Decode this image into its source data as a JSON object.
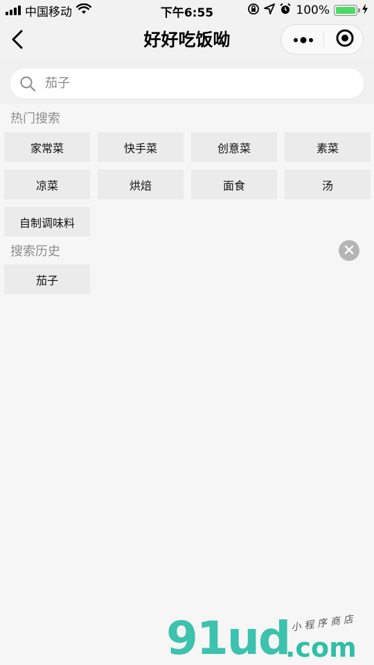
{
  "status_bar": {
    "carrier": "中国移动",
    "time": "下午6:55",
    "battery_percent": "100%",
    "battery_level": 1.0,
    "battery_color": "#4cd964"
  },
  "nav": {
    "title": "好好吃饭呦",
    "back_icon": "chevron-left-icon",
    "more_icon": "more-dots-icon",
    "close_icon": "target-circle-icon"
  },
  "search": {
    "placeholder": "茄子",
    "value": "",
    "icon": "search-icon"
  },
  "hot_search": {
    "title": "热门搜索",
    "tags": [
      "家常菜",
      "快手菜",
      "创意菜",
      "素菜",
      "凉菜",
      "烘焙",
      "面食",
      "汤",
      "自制调味料"
    ]
  },
  "history": {
    "title": "搜索历史",
    "clear_icon": "clear-circle-icon",
    "tags": [
      "茄子"
    ]
  },
  "watermark": {
    "main": "91ud",
    "suffix": ".com",
    "tagline": "小程序商店"
  },
  "colors": {
    "page_background": "#f6f6f6",
    "tag_background": "#ebebeb",
    "section_title": "#8c8c8c",
    "watermark": "#3cc2ad"
  }
}
